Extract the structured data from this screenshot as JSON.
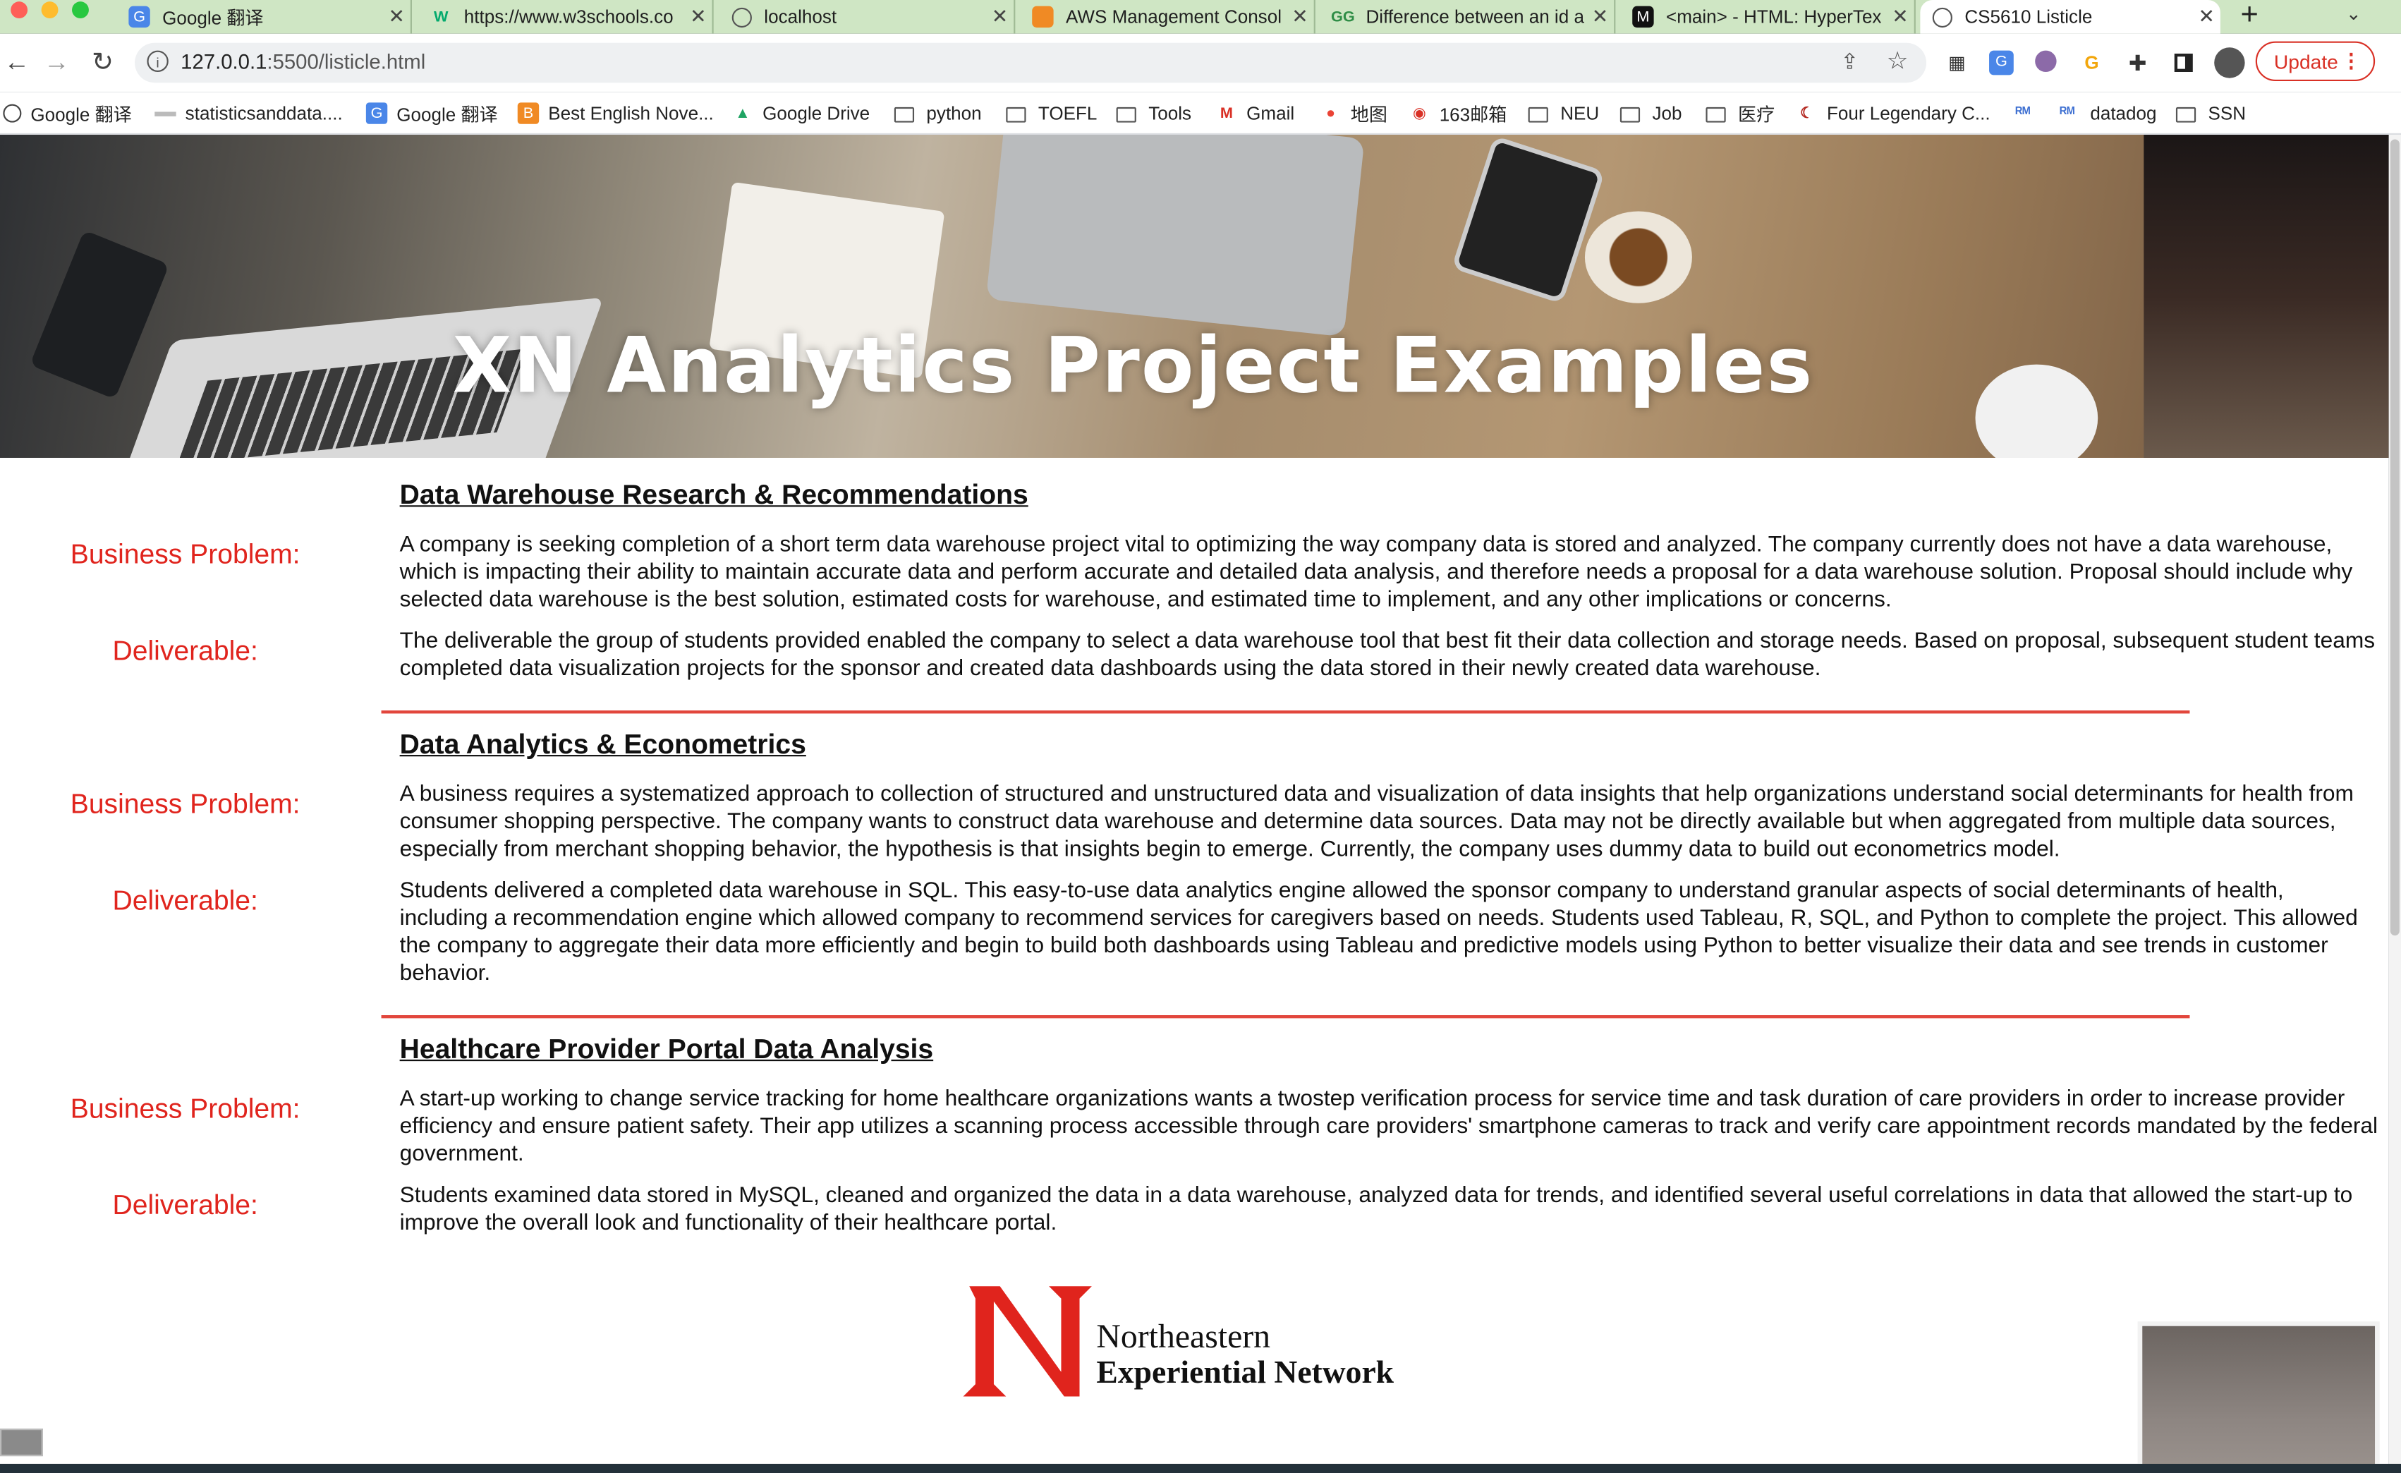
{
  "browser": {
    "tabs": [
      {
        "title": "Google 翻译",
        "icon": "google-translate-icon"
      },
      {
        "title": "https://www.w3schools.co",
        "icon": "w3schools-icon"
      },
      {
        "title": "localhost",
        "icon": "globe-icon"
      },
      {
        "title": "AWS Management Consol",
        "icon": "aws-icon"
      },
      {
        "title": "Difference between an id a",
        "icon": "geeksforgeeks-icon"
      },
      {
        "title": "<main> - HTML: HyperTex",
        "icon": "mdn-icon"
      },
      {
        "title": "CS5610 Listicle",
        "icon": "globe-icon",
        "active": true
      }
    ],
    "new_tab_label": "+",
    "address_host": "127.0.0.1",
    "address_path": ":5500/listicle.html",
    "update_label": "Update",
    "bookmarks": [
      {
        "label": "Google 翻译"
      },
      {
        "label": "statisticsanddata...."
      },
      {
        "label": "Google 翻译"
      },
      {
        "label": "Best English Nove..."
      },
      {
        "label": "Google Drive"
      },
      {
        "label": "python"
      },
      {
        "label": "TOEFL"
      },
      {
        "label": "Tools"
      },
      {
        "label": "Gmail"
      },
      {
        "label": "地图"
      },
      {
        "label": "163邮箱"
      },
      {
        "label": "NEU"
      },
      {
        "label": "Job"
      },
      {
        "label": "医疗"
      },
      {
        "label": "Four Legendary C..."
      },
      {
        "label": ""
      },
      {
        "label": "datadog"
      },
      {
        "label": "SSN"
      }
    ]
  },
  "page": {
    "hero_title": "XN Analytics Project Examples",
    "problem_label": "Business Problem:",
    "deliverable_label": "Deliverable:",
    "projects": [
      {
        "title": "Data Warehouse Research & Recommendations",
        "problem": "A company is seeking completion of a short term data warehouse project vital to optimizing the way company data is stored and analyzed. The company currently does not have a data warehouse, which is impacting their ability to maintain accurate data and perform accurate and detailed data analysis, and therefore needs a proposal for a data warehouse solution. Proposal should include why selected data warehouse is the best solution, estimated costs for warehouse, and estimated time to implement, and any other implications or concerns.",
        "deliverable": "The deliverable the group of students provided enabled the company to select a data warehouse tool that best fit their data collection and storage needs. Based on proposal, subsequent student teams completed data visualization projects for the sponsor and created data dashboards using the data stored in their newly created data warehouse."
      },
      {
        "title": "Data Analytics & Econometrics",
        "problem": "A business requires a systematized approach to collection of structured and unstructured data and visualization of data insights that help organizations understand social determinants for health from consumer shopping perspective. The company wants to construct data warehouse and determine data sources. Data may not be directly available but when aggregated from multiple data sources, especially from merchant shopping behavior, the hypothesis is that insights begin to emerge. Currently, the company uses dummy data to build out econometrics model.",
        "deliverable": "Students delivered a completed data warehouse in SQL. This easy-to-use data analytics engine allowed the sponsor company to understand granular aspects of social determinants of health, including a recommendation engine which allowed company to recommend services for caregivers based on needs. Students used Tableau, R, SQL, and Python to complete the project. This allowed the company to aggregate their data more efficiently and begin to build both dashboards using Tableau and predictive models using Python to better visualize their data and see trends in customer behavior."
      },
      {
        "title": "Healthcare Provider Portal Data Analysis",
        "problem": "A start-up working to change service tracking for home healthcare organizations wants a twostep verification process for service time and task duration of care providers in order to increase provider efficiency and ensure patient safety. Their app utilizes a scanning process accessible through care providers' smartphone cameras to track and verify care appointment records mandated by the federal government.",
        "deliverable": "Students examined data stored in MySQL, cleaned and organized the data in a data warehouse, analyzed data for trends, and identified several useful correlations in data that allowed the start-up to improve the overall look and functionality of their healthcare portal."
      }
    ],
    "logo": {
      "line1": "Northeastern",
      "line2": "Experiential Network",
      "color": "#e0241d"
    }
  }
}
